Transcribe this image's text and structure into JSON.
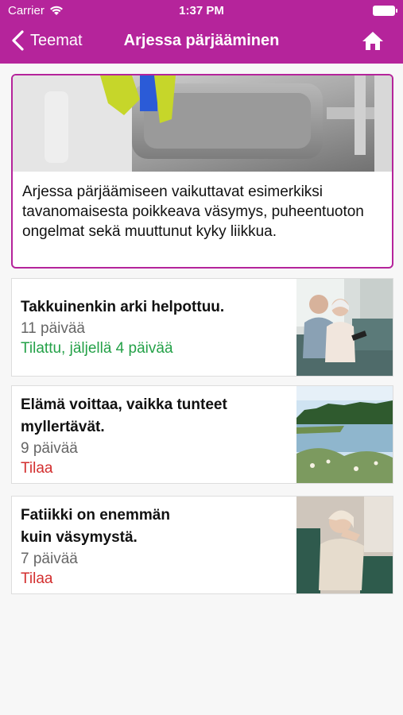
{
  "status_bar": {
    "carrier": "Carrier",
    "time": "1:37 PM"
  },
  "nav": {
    "back_label": "Teemat",
    "title": "Arjessa pärjääminen"
  },
  "intro": {
    "text": "Arjessa pärjäämiseen vaikuttavat esimerkiksi tavanomaisesta poikkeava väsymys, puheentuoton ongelmat sekä muuttunut kyky liikkua."
  },
  "courses": [
    {
      "title": "Takkuinenkin arki helpottuu.",
      "days": "11 päivää",
      "status": "Tilattu, jäljellä 4 päivää"
    },
    {
      "title_line1": "Elämä voittaa, vaikka tunteet",
      "title_line2": "myllertävät.",
      "days": "9 päivää",
      "status": "Tilaa"
    },
    {
      "title_line1": "Fatiikki on enemmän",
      "title_line2": "kuin väsymystä.",
      "days": "7 päivää",
      "status": "Tilaa"
    }
  ],
  "colors": {
    "brand": "#b5249b",
    "subscribed": "#24a148",
    "order": "#d32f2f"
  }
}
